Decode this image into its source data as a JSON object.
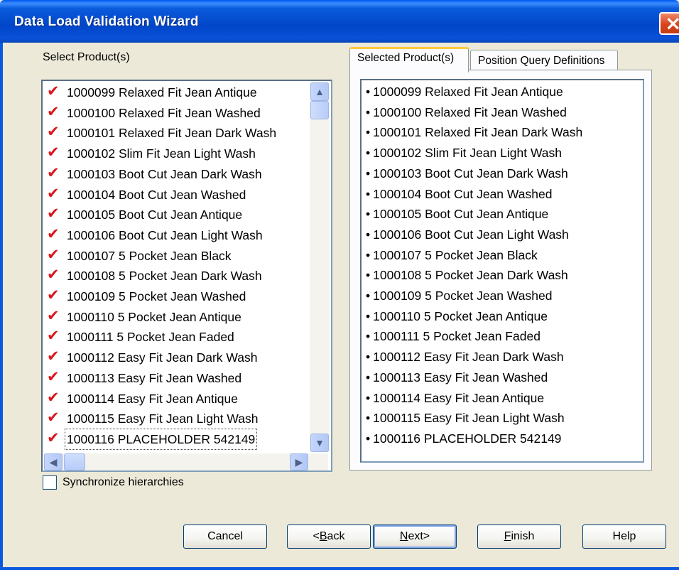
{
  "window": {
    "title": "Data Load Validation Wizard"
  },
  "left": {
    "label": "Select Product(s)",
    "items": [
      "1000099 Relaxed Fit Jean Antique",
      "1000100 Relaxed Fit Jean Washed",
      "1000101 Relaxed Fit Jean Dark Wash",
      "1000102 Slim Fit Jean Light Wash",
      "1000103 Boot Cut Jean Dark Wash",
      "1000104 Boot Cut Jean Washed",
      "1000105 Boot Cut Jean Antique",
      "1000106 Boot Cut Jean Light Wash",
      "1000107 5 Pocket Jean Black",
      "1000108 5 Pocket Jean Dark Wash",
      "1000109 5 Pocket Jean Washed",
      "1000110 5 Pocket Jean Antique",
      "1000111 5 Pocket Jean Faded",
      "1000112 Easy Fit Jean Dark Wash",
      "1000113 Easy Fit Jean Washed",
      "1000114 Easy Fit Jean Antique",
      "1000115 Easy Fit Jean Light Wash",
      "1000116 PLACEHOLDER 542149"
    ],
    "checked_glyph": "✔"
  },
  "sync": {
    "label": "Synchronize hierarchies",
    "checked": false
  },
  "tabs": [
    {
      "label": "Selected Product(s)",
      "active": true
    },
    {
      "label": "Position Query Definitions",
      "active": false
    }
  ],
  "right": {
    "bullet": "•",
    "items": [
      "1000099 Relaxed Fit Jean Antique",
      "1000100 Relaxed Fit Jean Washed",
      "1000101 Relaxed Fit Jean Dark Wash",
      "1000102 Slim Fit Jean Light Wash",
      "1000103 Boot Cut Jean Dark Wash",
      "1000104 Boot Cut Jean Washed",
      "1000105 Boot Cut Jean Antique",
      "1000106 Boot Cut Jean Light Wash",
      "1000107 5 Pocket Jean Black",
      "1000108 5 Pocket Jean Dark Wash",
      "1000109 5 Pocket Jean Washed",
      "1000110 5 Pocket Jean Antique",
      "1000111 5 Pocket Jean Faded",
      "1000112 Easy Fit Jean Dark Wash",
      "1000113 Easy Fit Jean Washed",
      "1000114 Easy Fit Jean Antique",
      "1000115 Easy Fit Jean Light Wash",
      "1000116 PLACEHOLDER 542149"
    ]
  },
  "buttons": {
    "cancel": "Cancel",
    "back": "<Back",
    "next": "Next>",
    "finish": "Finish",
    "help": "Help"
  },
  "colors": {
    "check": "#d9151c",
    "title_bar": "#0a58e0",
    "close": "#d9451c"
  },
  "icons": {
    "close": "close-icon",
    "scroll_up": "arrow-up-icon",
    "scroll_down": "arrow-down-icon",
    "scroll_left": "arrow-left-icon",
    "scroll_right": "arrow-right-icon"
  }
}
